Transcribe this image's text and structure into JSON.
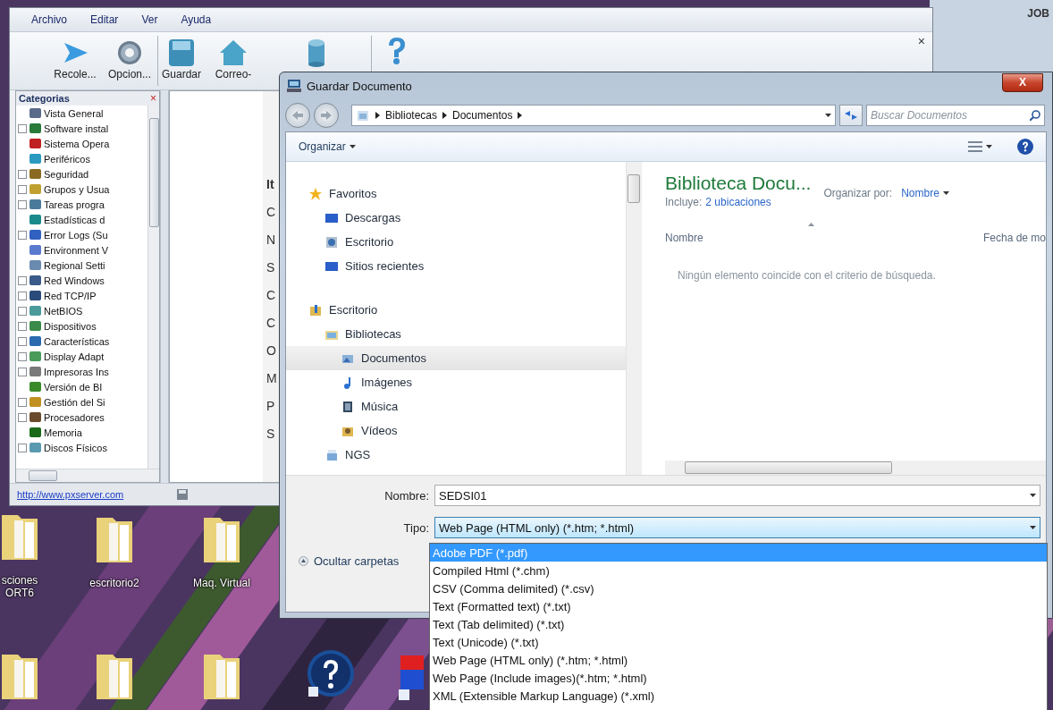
{
  "desktop": {
    "corner_text": "JOB",
    "icons": [
      {
        "kind": "folder",
        "label": "sciones ORT6"
      },
      {
        "kind": "folder",
        "label": "escritorio2"
      },
      {
        "kind": "folder",
        "label": "Maq. Virtual"
      },
      {
        "kind": "folder"
      },
      {
        "kind": "folder"
      },
      {
        "kind": "folder"
      },
      {
        "kind": "help"
      },
      {
        "kind": "shortcut"
      }
    ]
  },
  "app_window": {
    "menu": [
      "Archivo",
      "Editar",
      "Ver",
      "Ayuda"
    ],
    "close": "×",
    "toolbar": [
      {
        "kind": "arrow",
        "label": "Recole..."
      },
      {
        "kind": "gear",
        "label": "Opcion..."
      },
      {
        "kind": "disk",
        "label": "Guardar"
      },
      {
        "kind": "house",
        "label": "Correo-"
      },
      {
        "kind": "cylinder"
      },
      {
        "kind": "help"
      }
    ],
    "categories": {
      "title": "Categorias",
      "close": "×",
      "items": [
        {
          "label": "Vista General",
          "expandable": false
        },
        {
          "label": "Software instal",
          "expandable": true
        },
        {
          "label": "Sistema Opera",
          "expandable": false
        },
        {
          "label": "Periféricos",
          "expandable": false
        },
        {
          "label": "Seguridad",
          "expandable": true
        },
        {
          "label": "Grupos y Usua",
          "expandable": true
        },
        {
          "label": "Tareas progra",
          "expandable": true
        },
        {
          "label": "Estadísticas d",
          "expandable": false
        },
        {
          "label": "Error Logs (Su",
          "expandable": true
        },
        {
          "label": "Environment V",
          "expandable": false
        },
        {
          "label": "Regional Setti",
          "expandable": false
        },
        {
          "label": "Red Windows",
          "expandable": true
        },
        {
          "label": "Red TCP/IP",
          "expandable": true
        },
        {
          "label": "NetBIOS",
          "expandable": true
        },
        {
          "label": "Dispositivos",
          "expandable": true
        },
        {
          "label": "Características",
          "expandable": true
        },
        {
          "label": "Display Adapt",
          "expandable": true
        },
        {
          "label": "Impresoras Ins",
          "expandable": true
        },
        {
          "label": "Versión de BI",
          "expandable": false
        },
        {
          "label": "Gestión del Si",
          "expandable": true
        },
        {
          "label": "Procesadores",
          "expandable": true
        },
        {
          "label": "Memoria",
          "expandable": false
        },
        {
          "label": "Discos Físicos",
          "expandable": true
        }
      ]
    },
    "detail_labels": [
      "It",
      "C",
      "N",
      "S",
      "C",
      "C",
      "O",
      "M",
      "P",
      "S"
    ],
    "status_url": "http://www.pxserver.com"
  },
  "dialog": {
    "title": "Guardar Documento",
    "close": "X",
    "breadcrumb": [
      "Bibliotecas",
      "Documentos"
    ],
    "search": {
      "placeholder": "Buscar Documentos"
    },
    "organize": "Organizar",
    "navigation": [
      {
        "label": "Favoritos",
        "selected": false,
        "children": [
          {
            "label": "Descargas",
            "selected": false
          },
          {
            "label": "Escritorio",
            "selected": false
          },
          {
            "label": "Sitios recientes",
            "selected": false
          }
        ]
      },
      {
        "label": "Escritorio",
        "selected": false,
        "children": [
          {
            "label": "Bibliotecas",
            "selected": false,
            "children": [
              {
                "label": "Documentos",
                "selected": true
              },
              {
                "label": "Imágenes",
                "selected": false
              },
              {
                "label": "Música",
                "selected": false
              },
              {
                "label": "Vídeos",
                "selected": false
              }
            ]
          },
          {
            "label": "NGS",
            "selected": false
          }
        ]
      }
    ],
    "library": {
      "title": "Biblioteca Docu...",
      "includes_label": "Incluye:",
      "includes_link": "2 ubicaciones",
      "arrange_label": "Organizar por:",
      "arrange_value": "Nombre"
    },
    "columns": [
      "Nombre",
      "Fecha de mo"
    ],
    "empty_message": "Ningún elemento coincide con el criterio de búsqueda.",
    "filename_label": "Nombre:",
    "filename": "SEDSI01",
    "type_label": "Tipo:",
    "type_value": "Web Page (HTML only) (*.htm; *.html)",
    "hide_folders": "Ocultar carpetas",
    "type_options": [
      {
        "label": "Adobe PDF (*.pdf)",
        "selected": true
      },
      {
        "label": "Compiled Html (*.chm)",
        "selected": false
      },
      {
        "label": "CSV (Comma delimited) (*.csv)",
        "selected": false
      },
      {
        "label": "Text (Formatted text) (*.txt)",
        "selected": false
      },
      {
        "label": "Text (Tab delimited) (*.txt)",
        "selected": false
      },
      {
        "label": "Text (Unicode) (*.txt)",
        "selected": false
      },
      {
        "label": "Web Page (HTML only) (*.htm; *.html)",
        "selected": false
      },
      {
        "label": "Web Page (Include images)(*.htm; *.html)",
        "selected": false
      },
      {
        "label": "XML (Extensible Markup Language) (*.xml)",
        "selected": false
      }
    ]
  }
}
